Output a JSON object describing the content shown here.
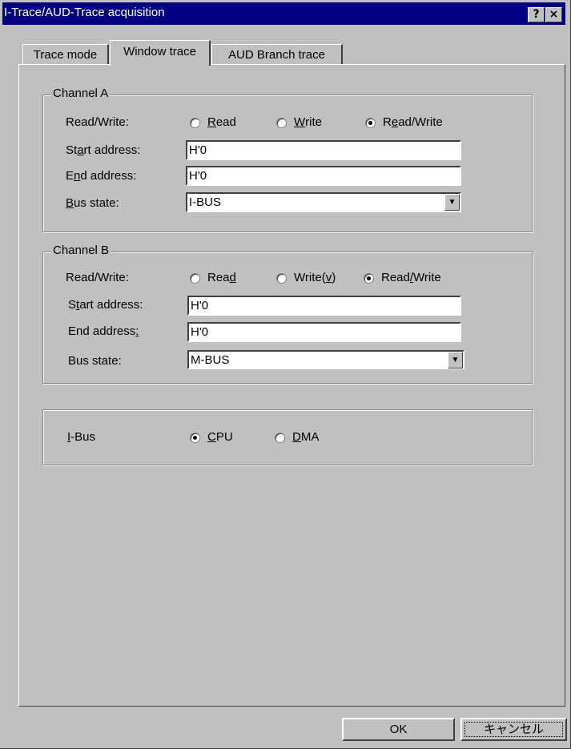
{
  "window": {
    "title": "I-Trace/AUD-Trace acquisition",
    "help": "?",
    "close": "×"
  },
  "tabs": [
    {
      "label": "Trace mode"
    },
    {
      "label": "Window trace"
    },
    {
      "label": "AUD Branch trace"
    }
  ],
  "channel_a": {
    "legend": "Channel A",
    "rw_label": "Read/Write:",
    "radios": [
      {
        "pre": "",
        "u": "R",
        "post": "ead",
        "checked": false
      },
      {
        "pre": "",
        "u": "W",
        "post": "rite",
        "checked": false
      },
      {
        "pre": "R",
        "u": "e",
        "post": "ad/Write",
        "checked": true
      }
    ],
    "start_label": {
      "pre": "St",
      "u": "a",
      "post": "rt address:"
    },
    "start_value": "H'0",
    "end_label": {
      "pre": "E",
      "u": "n",
      "post": "d address:"
    },
    "end_value": "H'0",
    "bus_label": {
      "pre": "",
      "u": "B",
      "post": "us state:"
    },
    "bus_value": "I-BUS"
  },
  "channel_b": {
    "legend": "Channel B",
    "rw_label": "Read/Write:",
    "radios": [
      {
        "pre": "Rea",
        "u": "d",
        "post": "",
        "checked": false
      },
      {
        "pre": "Write(",
        "u": "v",
        "post": ")",
        "checked": false
      },
      {
        "pre": "Read",
        "u": "/",
        "post": "Write",
        "checked": true
      }
    ],
    "start_label": {
      "pre": "S",
      "u": "t",
      "post": "art address:"
    },
    "start_value": "H'0",
    "end_label": {
      "pre": "End address",
      "u": ":",
      "post": ""
    },
    "end_value": "H'0",
    "bus_label": {
      "pre": "Bus state:",
      "u": "",
      "post": ""
    },
    "bus_value": "M-BUS"
  },
  "ibus": {
    "label": {
      "pre": "",
      "u": "I",
      "post": "-Bus"
    },
    "radios": [
      {
        "pre": "",
        "u": "C",
        "post": "PU",
        "checked": true
      },
      {
        "pre": "",
        "u": "D",
        "post": "MA",
        "checked": false
      }
    ]
  },
  "buttons": {
    "ok": "OK",
    "cancel": "キャンセル"
  }
}
